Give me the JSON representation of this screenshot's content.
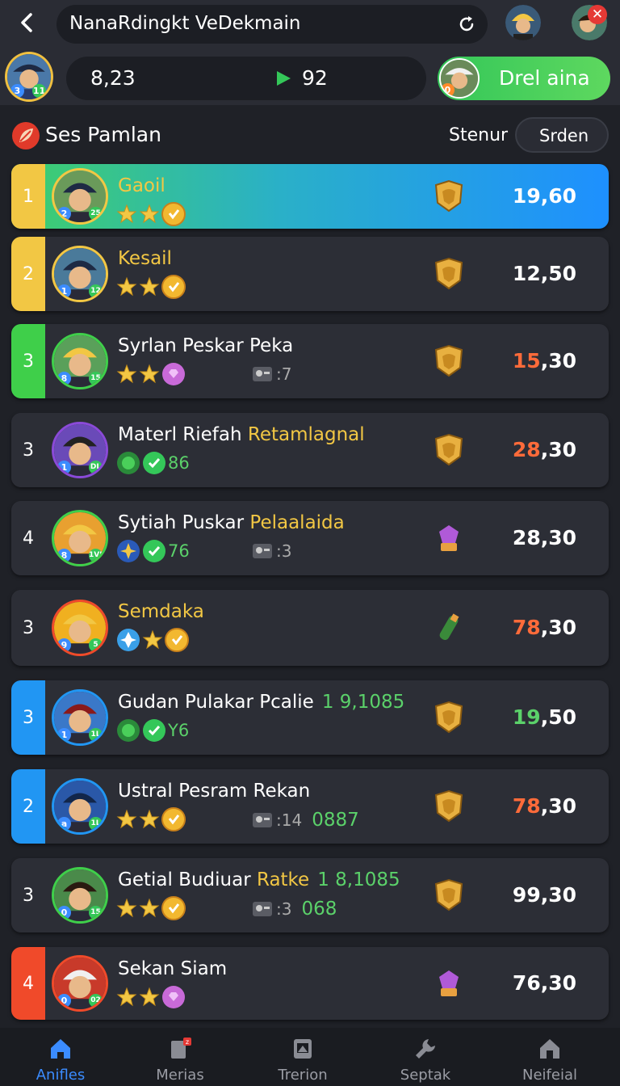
{
  "header": {
    "title": "NanaRdingkt VeDekmain",
    "stat_left": "8,23",
    "stat_right": "92",
    "action_button": "Drel aina",
    "me_badge_left": "3",
    "me_badge_right": "11",
    "action_badge": "0"
  },
  "section": {
    "title": "Ses Pamlan",
    "sort_label": "Stenur",
    "sort_button": "Srden"
  },
  "rows": [
    {
      "rank": "1",
      "name": "Gaoil",
      "name_hl": "",
      "name_green": "",
      "meta": "",
      "meta2": "",
      "score": "19,60",
      "badge_l": "2",
      "badge_r": "25"
    },
    {
      "rank": "2",
      "name": "Kesail",
      "name_hl": "",
      "name_green": "",
      "meta": "",
      "meta2": "",
      "score": "12,50",
      "badge_l": "1",
      "badge_r": "12"
    },
    {
      "rank": "3",
      "name": "Syrlan Peskar Peka",
      "name_hl": "",
      "name_green": "",
      "meta": ":7",
      "meta2": "",
      "score": "15,30",
      "badge_l": "8",
      "badge_r": "15"
    },
    {
      "rank": "3",
      "name": "Materl Riefah ",
      "name_hl": "Retamlagnal",
      "name_green": "",
      "meta": "86",
      "meta2": "",
      "score": "28,30",
      "badge_l": "1",
      "badge_r": "DL"
    },
    {
      "rank": "4",
      "name": "Sytiah Puskar ",
      "name_hl": "Pelaalaida",
      "name_green": "",
      "meta": "76",
      "meta2": ":3",
      "score": "28,30",
      "badge_l": "8",
      "badge_r": "1VL"
    },
    {
      "rank": "3",
      "name": "Semdaka",
      "name_hl": "",
      "name_green": "",
      "meta": "",
      "meta2": "",
      "score": "78,30",
      "badge_l": "9",
      "badge_r": "5"
    },
    {
      "rank": "3",
      "name": "Gudan Pulakar Pcalie",
      "name_hl": "",
      "name_green": "1 9,1085",
      "meta": "Y6",
      "meta2": "",
      "score": "19,50",
      "badge_l": "1",
      "badge_r": "1L"
    },
    {
      "rank": "2",
      "name": "Ustral Pesram Rekan",
      "name_hl": "",
      "name_green": "",
      "meta": ":14",
      "meta2": "0887",
      "score": "78,30",
      "badge_l": "a",
      "badge_r": "1L"
    },
    {
      "rank": "3",
      "name": "Getial Budiuar ",
      "name_hl": "Ratke",
      "name_green": "1 8,1085",
      "meta": ":3",
      "meta2": "068",
      "score": "99,30",
      "badge_l": "0",
      "badge_r": "15"
    },
    {
      "rank": "4",
      "name": "Sekan Siam",
      "name_hl": "",
      "name_green": "",
      "meta": "",
      "meta2": "",
      "score": "76,30",
      "badge_l": "0",
      "badge_r": "02"
    }
  ],
  "nav": [
    {
      "label": "Anifles"
    },
    {
      "label": "Merias"
    },
    {
      "label": "Trerion"
    },
    {
      "label": "Septak"
    },
    {
      "label": "Neifeial"
    }
  ],
  "colors": {
    "accent_blue": "#3b8cff",
    "accent_green": "#34c759",
    "gold": "#f2c744",
    "orange": "#ff6b3a"
  }
}
